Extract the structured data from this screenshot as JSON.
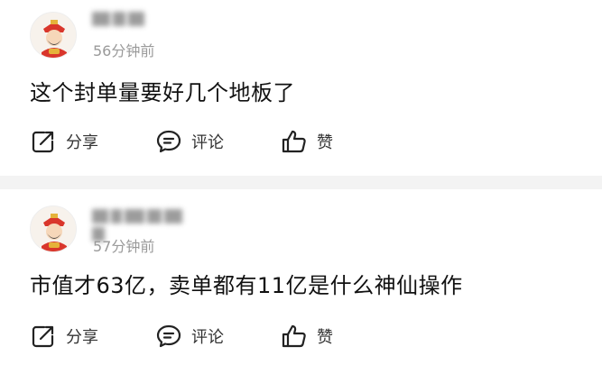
{
  "posts": [
    {
      "time": "56分钟前",
      "content": "这个封单量要好几个地板了",
      "actions": {
        "share": "分享",
        "comment": "评论",
        "like": "赞"
      }
    },
    {
      "time": "57分钟前",
      "content": "市值才63亿，卖单都有11亿是什么神仙操作",
      "actions": {
        "share": "分享",
        "comment": "评论",
        "like": "赞"
      }
    }
  ],
  "colors": {
    "background": "#f3f3f3",
    "card": "#ffffff",
    "text": "#111111",
    "muted": "#9a9a9a"
  },
  "icons": [
    "avatar-icon",
    "share-icon",
    "comment-icon",
    "like-icon"
  ]
}
